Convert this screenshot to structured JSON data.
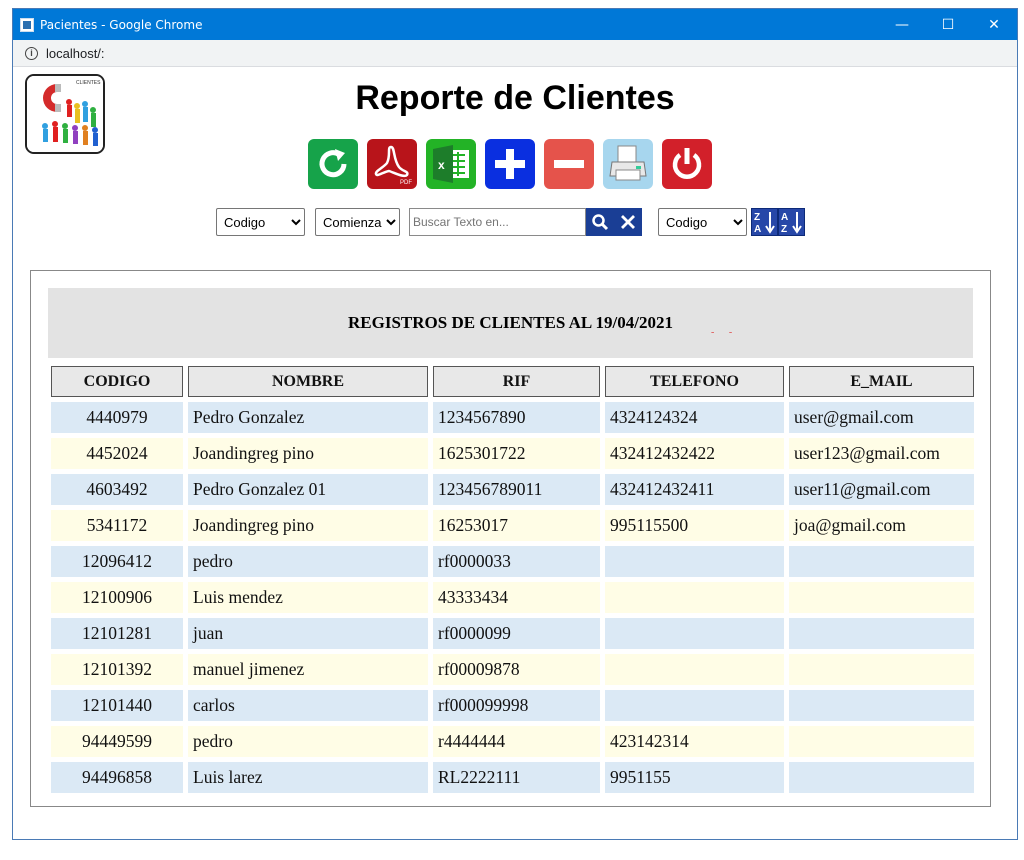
{
  "window": {
    "title": "Pacientes - Google Chrome",
    "url": "localhost/:",
    "minimize": "—",
    "maximize": "☐",
    "close": "✕"
  },
  "page": {
    "title": "Reporte de Clientes",
    "logo_text": "CLIENTES"
  },
  "toolbar": {
    "pdf_label": "PDF"
  },
  "filters": {
    "field_options": [
      "Codigo"
    ],
    "field_value": "Codigo",
    "mode_options": [
      "Comienza"
    ],
    "mode_value": "Comienza",
    "search_placeholder": "Buscar Texto en...",
    "order_options": [
      "Codigo"
    ],
    "order_value": "Codigo"
  },
  "report": {
    "heading": "REGISTROS DE CLIENTES AL 19/04/2021",
    "marks": "- -",
    "columns": [
      "CODIGO",
      "NOMBRE",
      "RIF",
      "TELEFONO",
      "E_MAIL"
    ],
    "rows": [
      {
        "codigo": "4440979",
        "nombre": "Pedro Gonzalez",
        "rif": "1234567890",
        "telefono": "4324124324",
        "email": "user@gmail.com"
      },
      {
        "codigo": "4452024",
        "nombre": "Joandingreg pino",
        "rif": "1625301722",
        "telefono": "432412432422",
        "email": "user123@gmail.com"
      },
      {
        "codigo": "4603492",
        "nombre": "Pedro Gonzalez 01",
        "rif": "123456789011",
        "telefono": "432412432411",
        "email": "user11@gmail.com"
      },
      {
        "codigo": "5341172",
        "nombre": "Joandingreg pino",
        "rif": "16253017",
        "telefono": "995115500",
        "email": "joa@gmail.com"
      },
      {
        "codigo": "12096412",
        "nombre": "pedro",
        "rif": "rf0000033",
        "telefono": "",
        "email": ""
      },
      {
        "codigo": "12100906",
        "nombre": "Luis mendez",
        "rif": "43333434",
        "telefono": "",
        "email": ""
      },
      {
        "codigo": "12101281",
        "nombre": "juan",
        "rif": "rf0000099",
        "telefono": "",
        "email": ""
      },
      {
        "codigo": "12101392",
        "nombre": "manuel jimenez",
        "rif": "rf00009878",
        "telefono": "",
        "email": ""
      },
      {
        "codigo": "12101440",
        "nombre": "carlos",
        "rif": "rf000099998",
        "telefono": "",
        "email": ""
      },
      {
        "codigo": "94449599",
        "nombre": "pedro",
        "rif": "r4444444",
        "telefono": "423142314",
        "email": ""
      },
      {
        "codigo": "94496858",
        "nombre": "Luis larez",
        "rif": "RL2222111",
        "telefono": "9951155",
        "email": ""
      }
    ]
  }
}
